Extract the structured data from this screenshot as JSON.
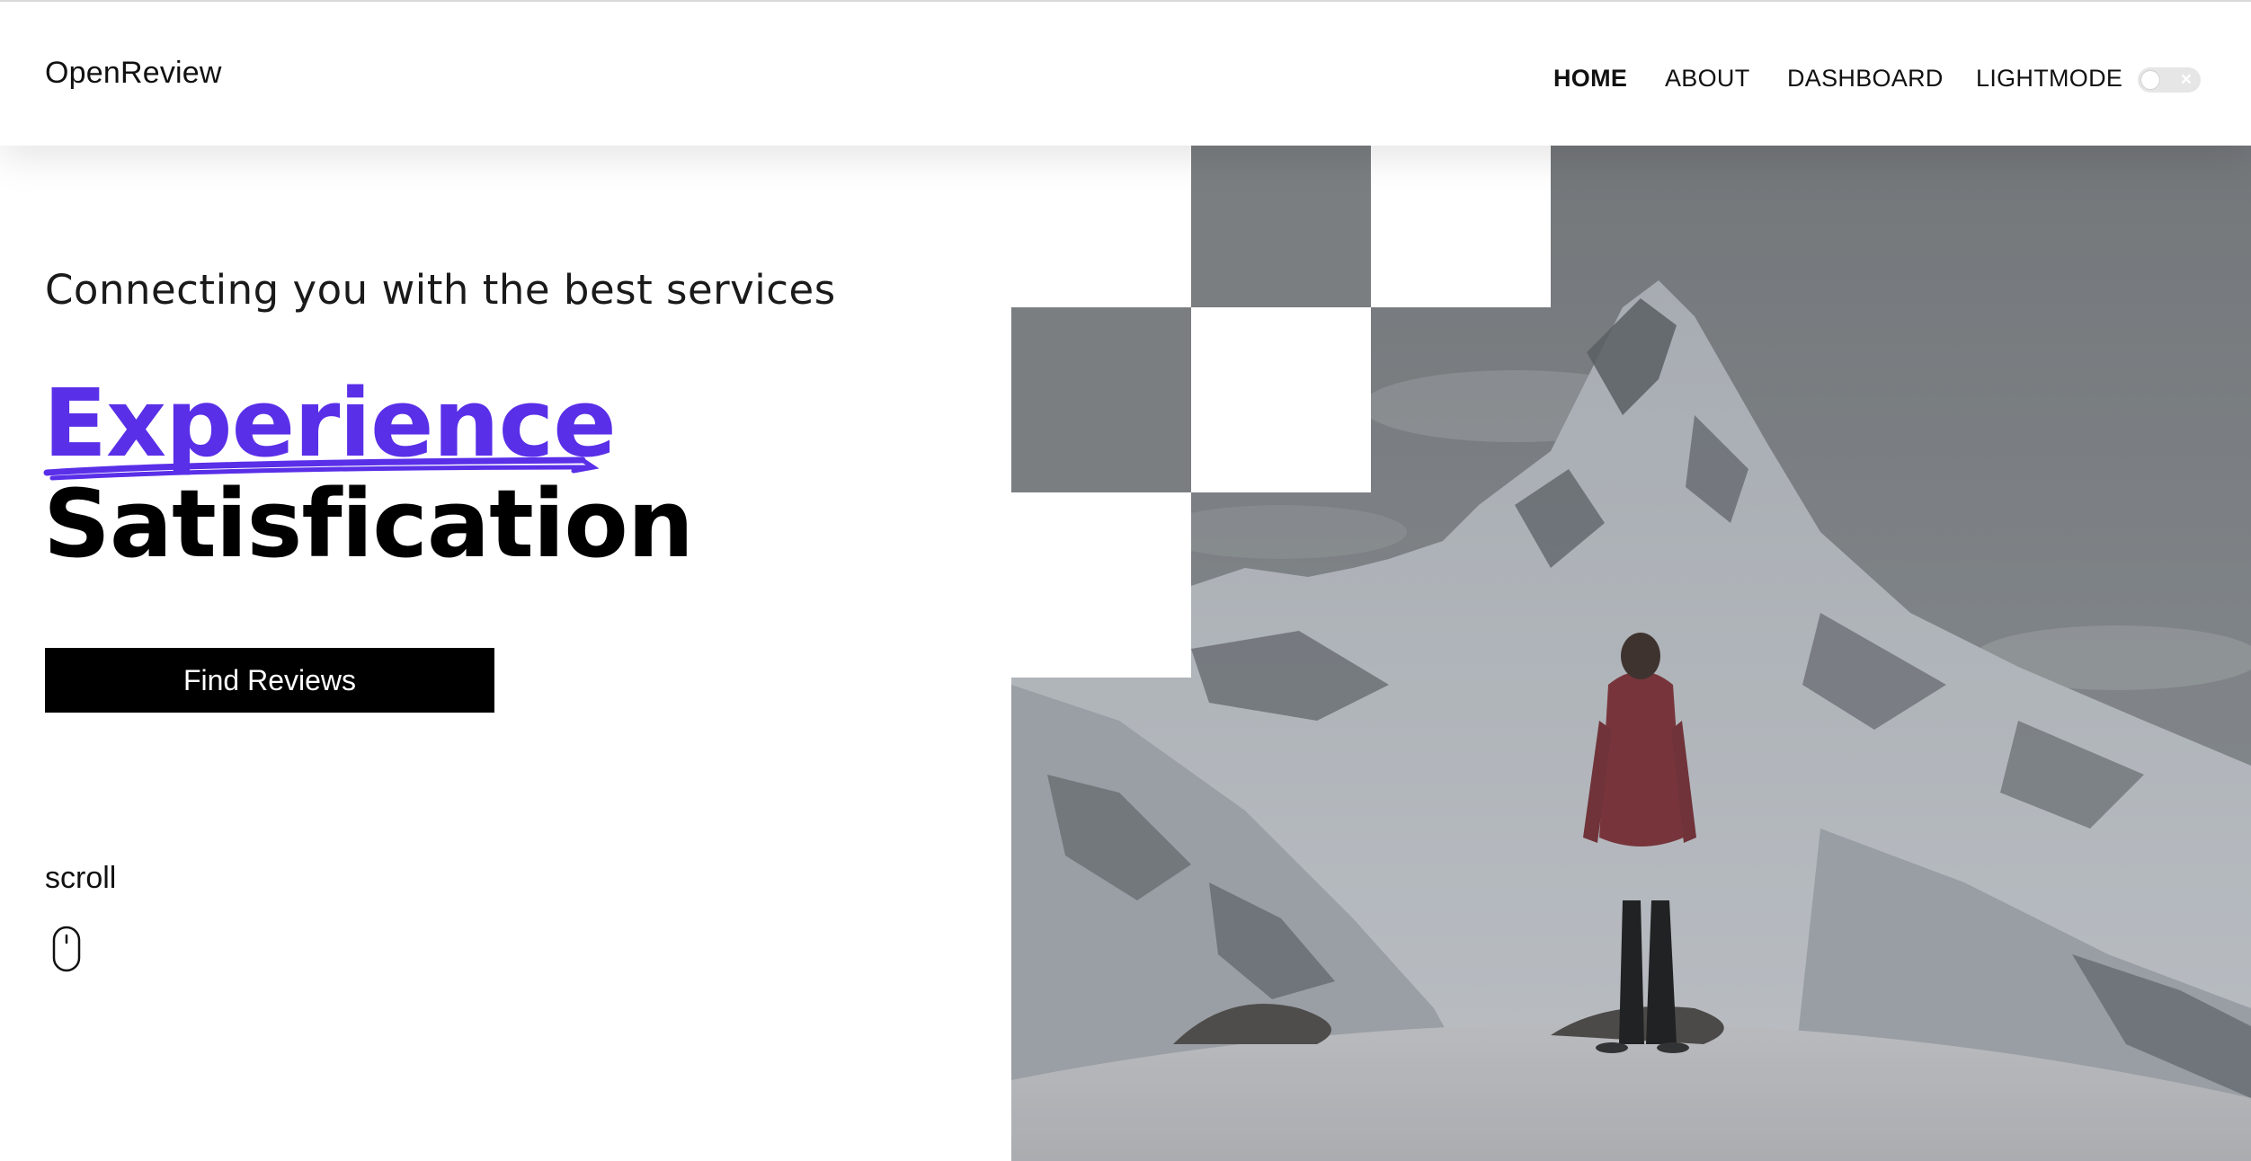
{
  "header": {
    "logo": "OpenReview",
    "nav": [
      {
        "label": "HOME",
        "active": true
      },
      {
        "label": "ABOUT",
        "active": false
      },
      {
        "label": "DASHBOARD",
        "active": false
      },
      {
        "label": "LIGHTMODE",
        "active": false
      }
    ],
    "theme_toggle": {
      "state": "off",
      "icon": "close-icon"
    }
  },
  "hero": {
    "tagline": "Connecting you with the best services",
    "headline_accent": "Experience",
    "headline_main": "Satisfication",
    "cta_label": "Find Reviews",
    "scroll_label": "scroll",
    "scroll_icon": "mouse-icon",
    "image": "mountain-hiker-image"
  },
  "colors": {
    "accent": "#5a2fe8",
    "text": "#000000",
    "button_bg": "#000000",
    "button_text": "#ffffff",
    "image_overlay": "#6f7478"
  }
}
